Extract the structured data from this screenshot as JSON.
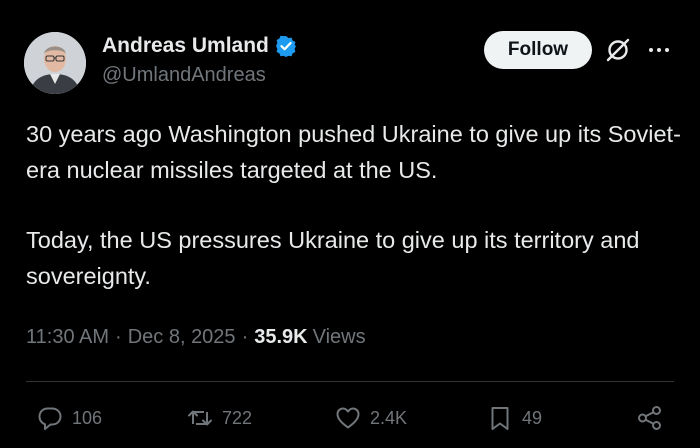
{
  "author": {
    "name": "Andreas Umland",
    "handle": "@UmlandAndreas",
    "verified": true
  },
  "follow_label": "Follow",
  "tweet": {
    "paragraphs": [
      "30 years ago Washington pushed Ukraine to give up its Soviet-era nuclear missiles targeted at the US.",
      "Today, the US pressures Ukraine to give up its territory and sovereignty."
    ]
  },
  "meta": {
    "time": "11:30 AM",
    "date": "Dec 8, 2025",
    "views_count": "35.9K",
    "views_label": "Views",
    "separator": "·"
  },
  "actions": {
    "replies": "106",
    "reposts": "722",
    "likes": "2.4K",
    "bookmarks": "49"
  },
  "colors": {
    "background": "#000000",
    "text": "#e7e9ea",
    "muted": "#71767b",
    "verified": "#1d9bf0",
    "follow_bg": "#eff3f4"
  },
  "icons": [
    "verified-badge-icon",
    "grok-icon",
    "more-icon",
    "reply-icon",
    "repost-icon",
    "like-icon",
    "bookmark-icon",
    "share-icon"
  ]
}
